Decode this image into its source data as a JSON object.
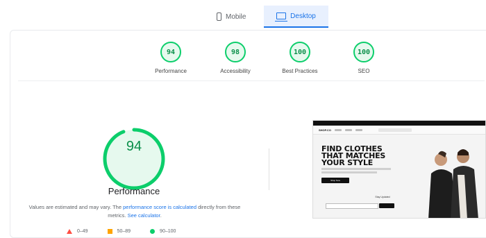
{
  "tabs": [
    {
      "label": "Mobile",
      "active": false
    },
    {
      "label": "Desktop",
      "active": true
    }
  ],
  "categories": [
    {
      "score": "94",
      "label": "Performance"
    },
    {
      "score": "98",
      "label": "Accessibility"
    },
    {
      "score": "100",
      "label": "Best Practices"
    },
    {
      "score": "100",
      "label": "SEO"
    }
  ],
  "main": {
    "score": "94",
    "score_fraction": 0.94,
    "title": "Performance",
    "note_prefix": "Values are estimated and may vary. The ",
    "note_link1": "performance score is calculated",
    "note_middle": " directly from these metrics. ",
    "note_link2": "See calculator",
    "note_suffix": "."
  },
  "legend": [
    {
      "icon": "red-triangle",
      "range": "0–49"
    },
    {
      "icon": "orange-square",
      "range": "50–89"
    },
    {
      "icon": "green-circle",
      "range": "90–100"
    }
  ],
  "screenshot": {
    "brand": "SHOP.CO",
    "headline_1": "FIND CLOTHES",
    "headline_2": "THAT MATCHES",
    "headline_3": "YOUR STYLE",
    "cta": "Shop Now",
    "signup": "Stay Updated"
  },
  "colors": {
    "pass": "#0cce6b",
    "average": "#ffa400",
    "fail": "#ff4e42",
    "accent": "#1a73e8"
  }
}
